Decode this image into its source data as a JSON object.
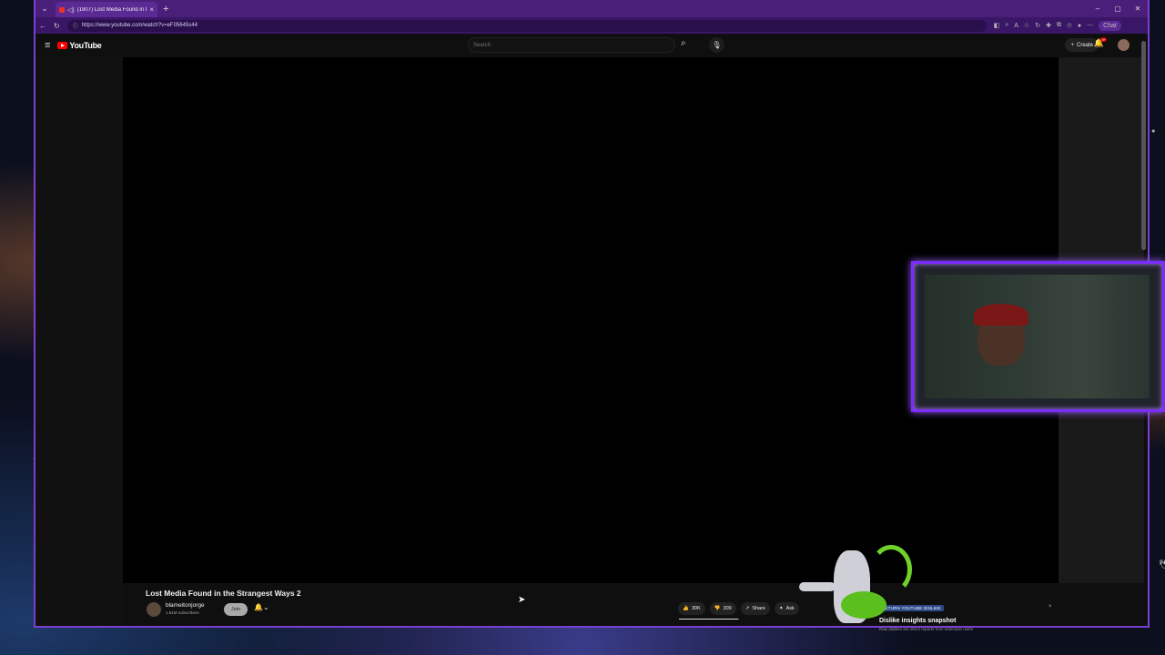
{
  "browser": {
    "tab_title": "(1907) Lost Media Found in th",
    "new_tab": "+",
    "url": "https://www.youtube.com/watch?v=eF05645s44",
    "chat_label": "Chat"
  },
  "youtube": {
    "logo_text": "YouTube",
    "search_placeholder": "Search",
    "create_label": "Create",
    "notification_count": "9+"
  },
  "video": {
    "title": "Lost Media Found in the Strangest Ways 2",
    "channel_name": "blameitonjorge",
    "channel_subs": "1.81M subscribers",
    "join_label": "Join",
    "likes": "30K",
    "dislikes": "309",
    "like_fraction": 0.99,
    "share_label": "Share",
    "ask_label": "Ask"
  },
  "ryd": {
    "badge": "RETURN YOUTUBE DISLIKE",
    "title": "Dislike insights snapshot",
    "subtitle": "Raw dislikes are direct reports from extension users",
    "close": "×"
  },
  "icons": {
    "tab_menu": "tab-list-icon",
    "audio": "speaker-icon",
    "mic": "microphone-icon",
    "search": "search-icon",
    "bell": "bell-icon"
  },
  "colors": {
    "accent": "#7a3fd0",
    "tabstrip": "#4a1f7a",
    "webcam_border": "#7a2cff",
    "yt_red": "#ff0000"
  }
}
